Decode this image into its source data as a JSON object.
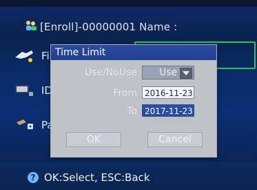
{
  "header": {
    "title": "[Enroll]-00000001 Name :",
    "icon": "user-group-icon"
  },
  "menu": {
    "items": [
      {
        "label": "Fi",
        "icon": "finger-icon"
      },
      {
        "label": "ID",
        "icon": "card-icon"
      },
      {
        "label": "Pa",
        "icon": "keys-lock-icon"
      }
    ]
  },
  "dialog": {
    "title": "Time Limit",
    "use_label": "Use/NoUse",
    "use_value": "Use",
    "from_label": "From",
    "from_value": "2016-11-23",
    "to_label": "To",
    "to_value": "2017-11-23",
    "ok_label": "OK",
    "cancel_label": "Cancel"
  },
  "footer": {
    "help_icon": "help-icon",
    "text": "OK:Select, ESC:Back"
  },
  "colors": {
    "accent": "#2b4ca3",
    "highlight": "#34c159",
    "header_bg": "#0e2a63"
  }
}
